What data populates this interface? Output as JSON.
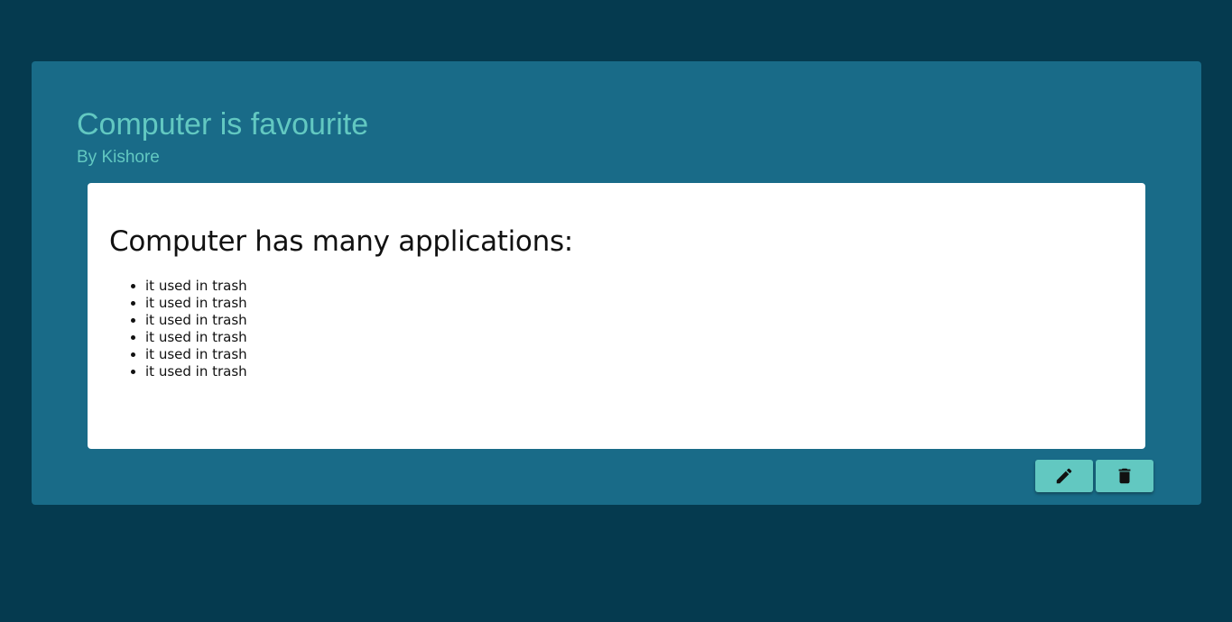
{
  "post": {
    "title": "Computer is favourite",
    "author": "By Kishore",
    "content": {
      "heading": "Computer has many applications:",
      "items": [
        "it used in trash",
        "it used in trash",
        "it used in trash",
        "it used in trash",
        "it used in trash",
        "it used in trash"
      ]
    }
  },
  "actions": {
    "edit_icon": "pencil-icon",
    "delete_icon": "trash-icon"
  },
  "colors": {
    "page_background": "#053a4f",
    "card_background": "#196b88",
    "accent": "#62c8c1",
    "content_background": "#ffffff",
    "text_dark": "#111111"
  }
}
